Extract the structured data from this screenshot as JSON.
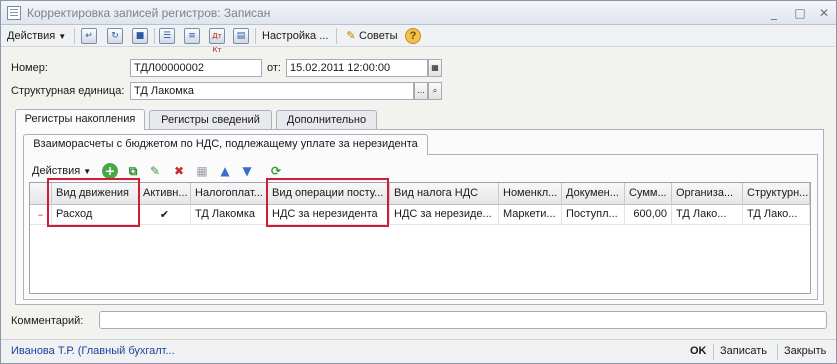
{
  "window": {
    "title": "Корректировка записей регистров: Записан",
    "controls": [
      "_",
      "□",
      "✕"
    ]
  },
  "toolbar": {
    "actions_label": "Действия",
    "settings_label": "Настройка ...",
    "tips_label": "Советы",
    "help_label": "?",
    "dtkt_label": "Дт Кт"
  },
  "form": {
    "number_label": "Номер:",
    "number_value": "ТДЛ00000002",
    "date_label": "от:",
    "date_value": "15.02.2011 12:00:00",
    "unit_label": "Структурная единица:",
    "unit_value": "ТД Лакомка",
    "comment_label": "Комментарий:",
    "comment_value": ""
  },
  "tabs": [
    "Регистры накопления",
    "Регистры сведений",
    "Дополнительно"
  ],
  "inner_tab": "Взаиморасчеты с бюджетом по НДС, подлежащему уплате за нерезидента",
  "grid_toolbar": {
    "actions_label": "Действия"
  },
  "table": {
    "columns": [
      "Вид движения",
      "Активн...",
      "Налогоплат...",
      "Вид операции посту...",
      "Вид налога НДС",
      "Номенкл...",
      "Докумен...",
      "Сумм...",
      "Организа...",
      "Структурн..."
    ],
    "rows": [
      [
        "Расход",
        "✔",
        "ТД Лакомка",
        "НДС за нерезидента",
        "НДС за нерезиде...",
        "Маркети...",
        "Поступл...",
        "600,00",
        "ТД Лако...",
        "ТД Лако..."
      ]
    ]
  },
  "status": {
    "user": "Иванова Т.Р. (Главный бухгалт...",
    "ok_label": "OK",
    "save_label": "Записать",
    "close_label": "Закрыть"
  },
  "colors": {
    "highlight": "#d21b35",
    "link": "#1f3f9a"
  }
}
